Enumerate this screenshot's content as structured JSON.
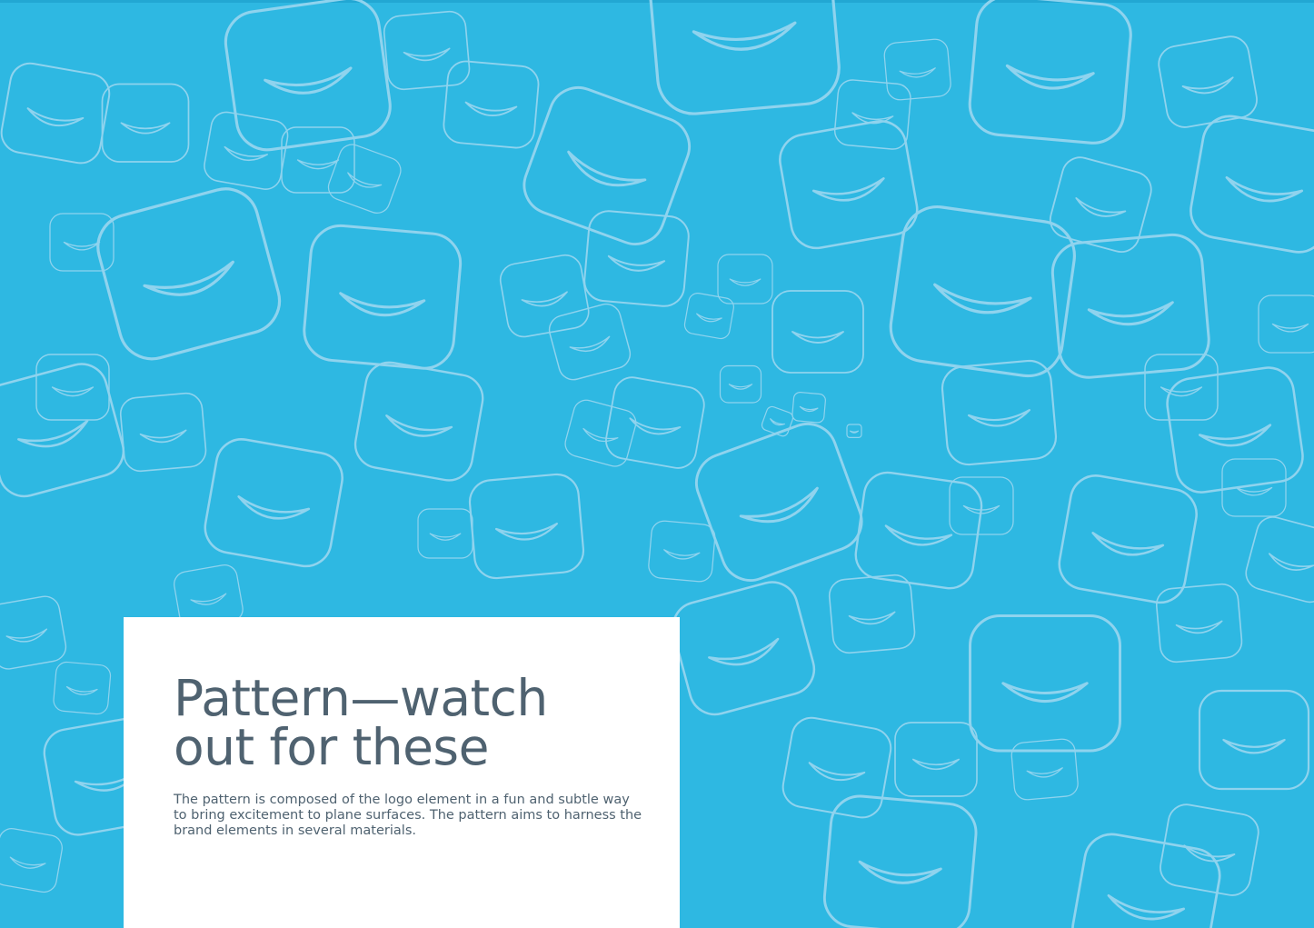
{
  "page": {
    "background_color": "#2eb8e2",
    "pattern_stroke_color": "#8fd3ee",
    "card_color": "#ffffff",
    "text_color": "#4f6270"
  },
  "card": {
    "title_line1": "Pattern—watch",
    "title_line2": "out for these",
    "body": "The pattern is composed of the logo element in a fun and subtle way to bring excitement to plane surfaces. The pattern aims to harness the brand elements in several materials."
  },
  "pattern": {
    "icon_name": "smile-square-icon"
  }
}
